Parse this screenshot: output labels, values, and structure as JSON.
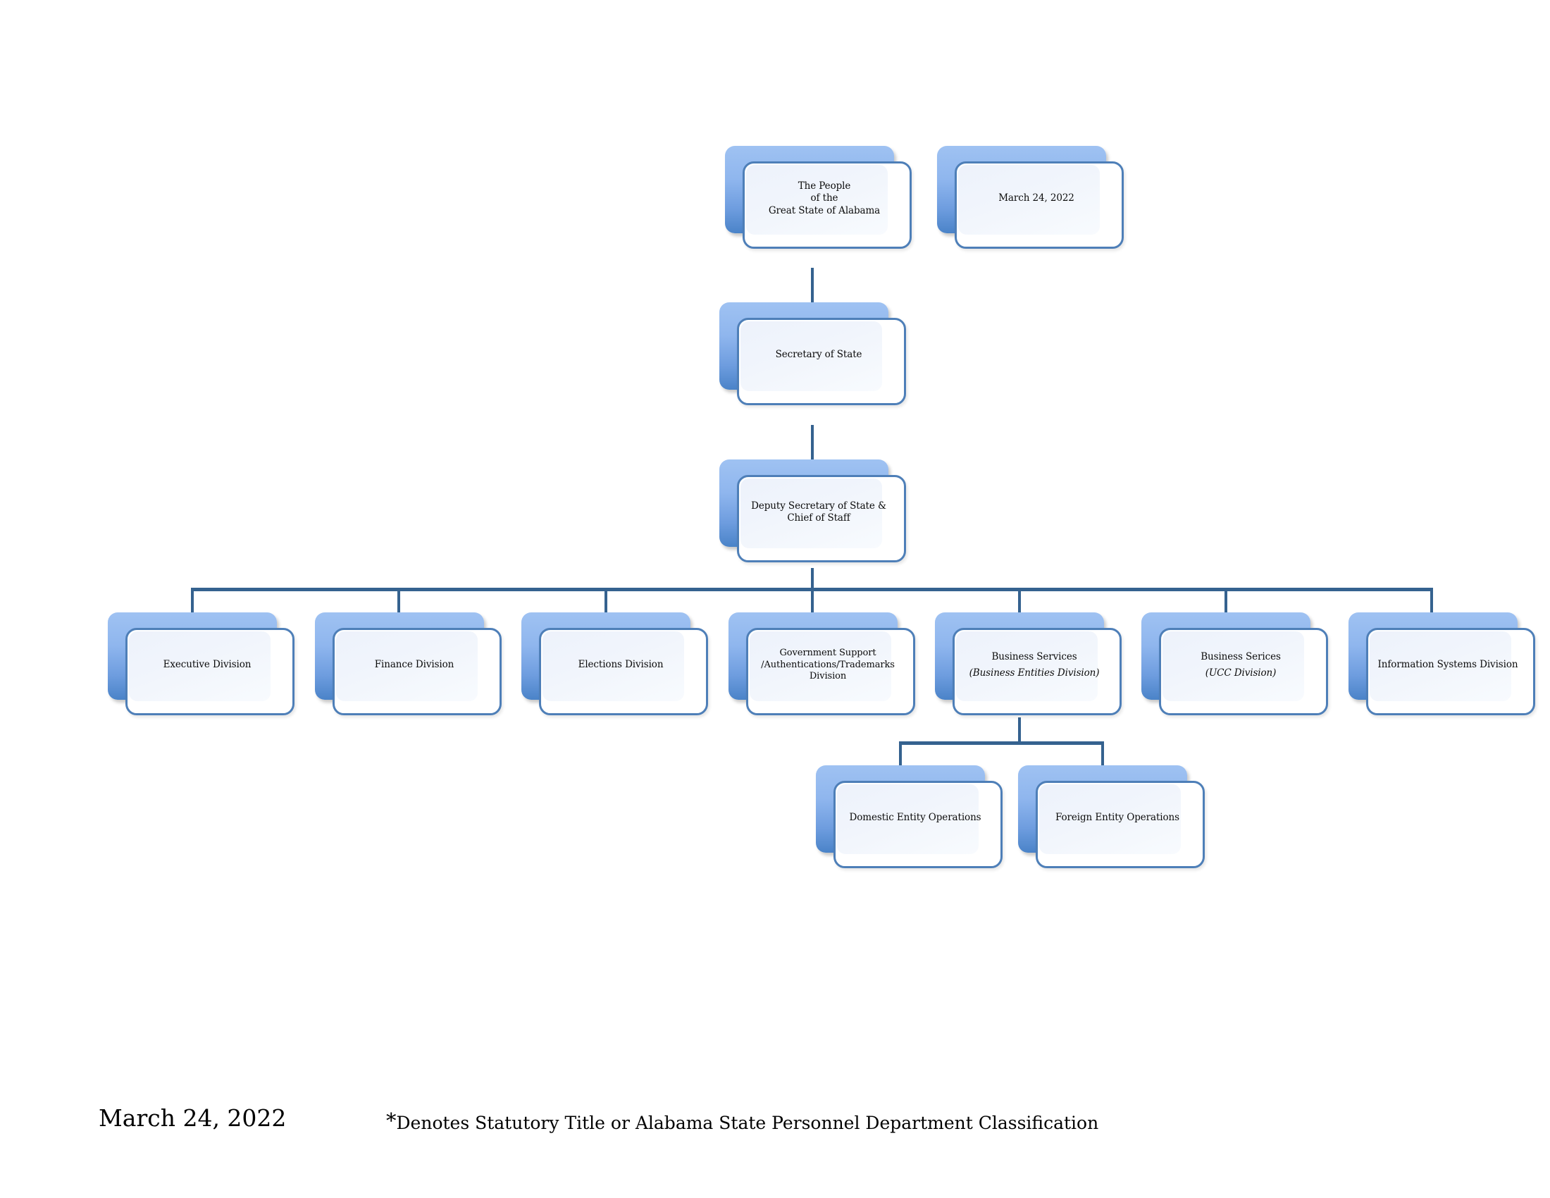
{
  "document": {
    "title": "Alabama Secretary of State Organizational Chart",
    "date_box": "March 24, 2022"
  },
  "colors": {
    "plate_top": "#9FC2F2",
    "plate_bottom": "#4A83C8",
    "card_border": "#4E7FB8",
    "card_fill": "#EDF2FB",
    "connector": "#35628F",
    "text": "#0b0b0b"
  },
  "nodes": {
    "people": {
      "line1": "The People",
      "line2": "of the",
      "line3": "Great State of Alabama"
    },
    "date": {
      "line1": "March 24, 2022"
    },
    "secretary": {
      "line1": "Secretary of State"
    },
    "deputy": {
      "line1": "Deputy Secretary of State &",
      "line2": "Chief of Staff"
    },
    "executive": {
      "line1": "Executive Division"
    },
    "finance": {
      "line1": "Finance Division"
    },
    "elections": {
      "line1": "Elections Division"
    },
    "govsupport": {
      "line1": "Government Support /Authentications/Trademarks Division"
    },
    "business_entities": {
      "line1": "Business Services",
      "line2": "(Business Entities Division)"
    },
    "business_ucc": {
      "line1": "Business Serices",
      "line2": "(UCC Division)"
    },
    "infosystems": {
      "line1": "Information Systems Division"
    },
    "domestic": {
      "line1": "Domestic Entity Operations"
    },
    "foreign": {
      "line1": "Foreign Entity Operations"
    }
  },
  "footer": {
    "date": "March 24, 2022",
    "star": "*",
    "note": "Denotes Statutory Title or Alabama State Personnel Department Classification"
  }
}
